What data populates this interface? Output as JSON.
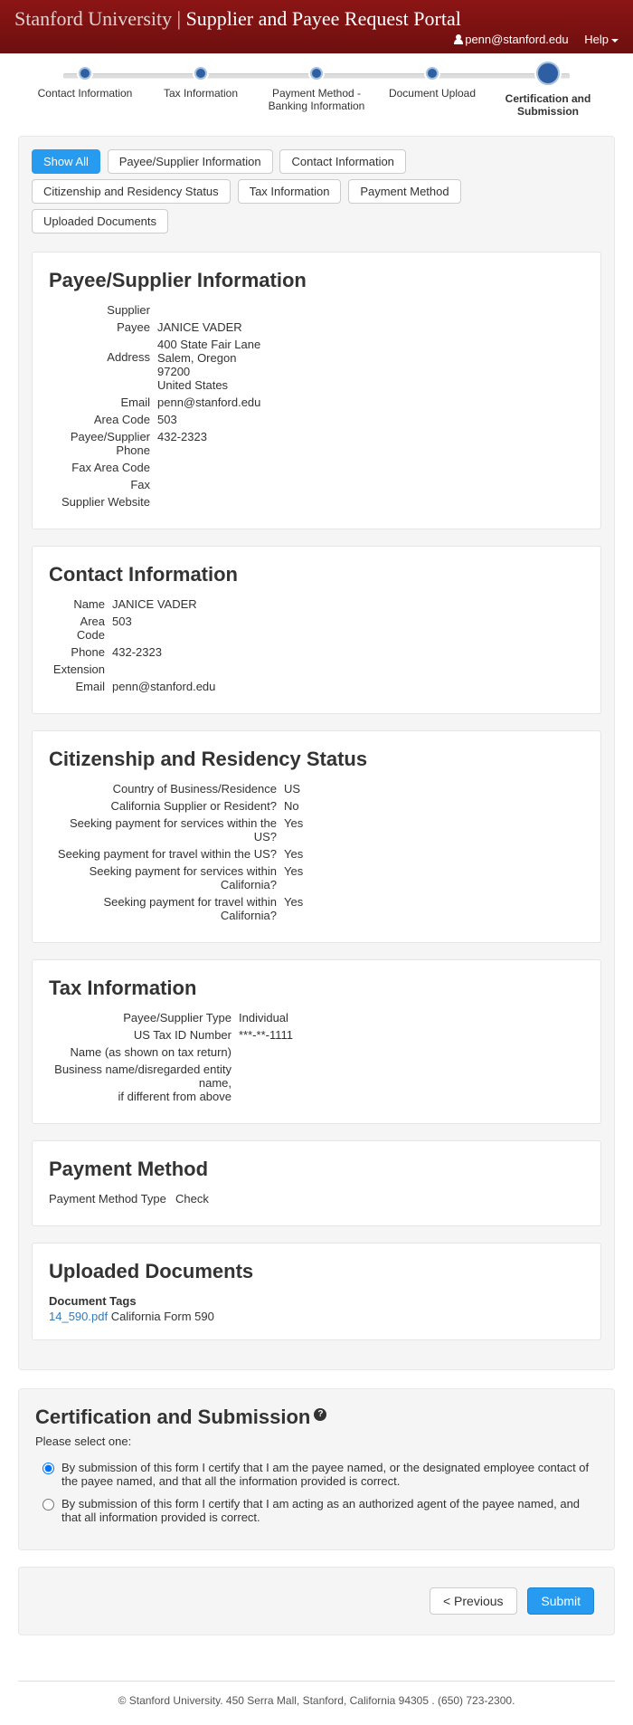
{
  "header": {
    "org": "Stanford University",
    "portal": "Supplier and Payee Request Portal",
    "user_email": "penn@stanford.edu",
    "help_label": "Help"
  },
  "stepper": {
    "steps": [
      "Contact Information",
      "Tax Information",
      "Payment Method - Banking Information",
      "Document Upload",
      "Certification and Submission"
    ]
  },
  "tabs": {
    "items": [
      "Show All",
      "Payee/Supplier Information",
      "Contact Information",
      "Citizenship and Residency Status",
      "Tax Information",
      "Payment Method",
      "Uploaded Documents"
    ]
  },
  "payee_supplier": {
    "title": "Payee/Supplier Information",
    "supplier_label": "Supplier",
    "supplier_value": "",
    "payee_label": "Payee",
    "payee_value": "JANICE VADER",
    "address_label": "Address",
    "address_line1": "400 State Fair Lane",
    "address_line2": "Salem, Oregon",
    "address_line3": "97200",
    "address_line4": "United States",
    "email_label": "Email",
    "email_value": "penn@stanford.edu",
    "area_code_label": "Area Code",
    "area_code_value": "503",
    "phone_label": "Payee/Supplier Phone",
    "phone_value": "432-2323",
    "fax_area_label": "Fax Area Code",
    "fax_area_value": "",
    "fax_label": "Fax",
    "fax_value": "",
    "website_label": "Supplier Website",
    "website_value": ""
  },
  "contact": {
    "title": "Contact Information",
    "name_label": "Name",
    "name_value": "JANICE VADER",
    "area_code_label": "Area Code",
    "area_code_value": "503",
    "phone_label": "Phone",
    "phone_value": "432-2323",
    "extension_label": "Extension",
    "extension_value": "",
    "email_label": "Email",
    "email_value": "penn@stanford.edu"
  },
  "citizenship": {
    "title": "Citizenship and Residency Status",
    "country_label": "Country of Business/Residence",
    "country_value": "US",
    "ca_resident_label": "California Supplier or Resident?",
    "ca_resident_value": "No",
    "svc_us_label": "Seeking payment for services within the US?",
    "svc_us_value": "Yes",
    "trv_us_label": "Seeking payment for travel within the US?",
    "trv_us_value": "Yes",
    "svc_ca_label": "Seeking payment for services within California?",
    "svc_ca_value": "Yes",
    "trv_ca_label": "Seeking payment for travel within California?",
    "trv_ca_value": "Yes"
  },
  "tax": {
    "title": "Tax Information",
    "type_label": "Payee/Supplier Type",
    "type_value": "Individual",
    "tin_label": "US Tax ID Number",
    "tin_value": "***-**-1111",
    "name_return_label": "Name (as shown on tax return)",
    "name_return_value": "",
    "biz_name_label_a": "Business name/disregarded entity name,",
    "biz_name_label_b": "if different from above",
    "biz_name_value": ""
  },
  "payment": {
    "title": "Payment Method",
    "type_label": "Payment Method Type",
    "type_value": "Check"
  },
  "uploads": {
    "title": "Uploaded Documents",
    "tags_header": "Document Tags",
    "doc_link": "14_590.pdf",
    "doc_desc": "California Form 590"
  },
  "certification": {
    "title": "Certification and Submission",
    "subtitle": "Please select one:",
    "option1": "By submission of this form I certify that I am the payee named, or the designated employee contact of the payee named, and that all the information provided is correct.",
    "option2": "By submission of this form I certify that I am acting as an authorized agent of the payee named, and that all information provided is correct."
  },
  "buttons": {
    "previous": "< Previous",
    "submit": "Submit"
  },
  "footer": "© Stanford University. 450 Serra Mall, Stanford, California 94305 . (650) 723-2300."
}
